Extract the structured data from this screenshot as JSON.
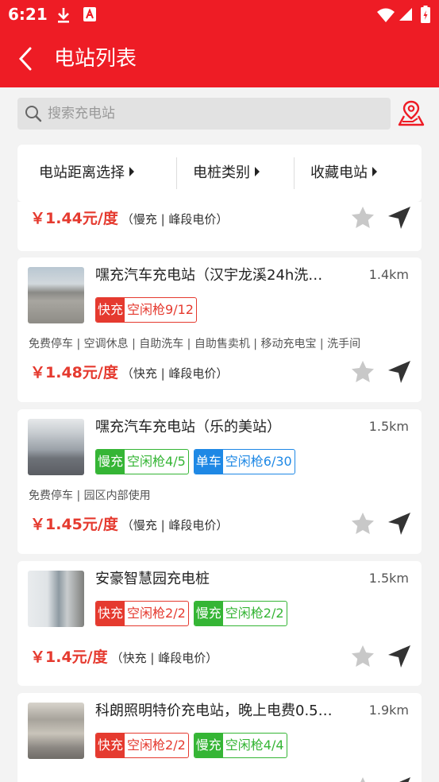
{
  "status_bar": {
    "time": "6:21"
  },
  "header": {
    "title": "电站列表"
  },
  "search": {
    "placeholder": "搜索充电站"
  },
  "filters": [
    {
      "label": "电站距离选择"
    },
    {
      "label": "电桩类别"
    },
    {
      "label": "收藏电站"
    }
  ],
  "partial_card": {
    "price": "￥1.44元/度",
    "price_desc": "（慢充 | 峰段电价）"
  },
  "stations": [
    {
      "name": "嘿充汽车充电站（汉宇龙溪24h洗…",
      "distance": "1.4km",
      "tags": [
        {
          "type": "快充",
          "avail": "空闲枪9/12",
          "kind": "fast"
        }
      ],
      "facilities": "免费停车 | 空调休息 | 自助洗车 | 自助售卖机 | 移动充电宝 | 洗手间",
      "price": "￥1.48元/度",
      "price_desc": "（快充 | 峰段电价）",
      "photo": "img-road"
    },
    {
      "name": "嘿充汽车充电站（乐的美站）",
      "distance": "1.5km",
      "tags": [
        {
          "type": "慢充",
          "avail": "空闲枪4/5",
          "kind": "slow"
        },
        {
          "type": "单车",
          "avail": "空闲枪6/30",
          "kind": "bike"
        }
      ],
      "facilities": "免费停车 | 园区内部使用",
      "price": "￥1.45元/度",
      "price_desc": "（慢充 | 峰段电价）",
      "photo": "img-bldg"
    },
    {
      "name": "安豪智慧园充电桩",
      "distance": "1.5km",
      "tags": [
        {
          "type": "快充",
          "avail": "空闲枪2/2",
          "kind": "fast"
        },
        {
          "type": "慢充",
          "avail": "空闲枪2/2",
          "kind": "slow"
        }
      ],
      "facilities": "",
      "price": "￥1.4元/度",
      "price_desc": "（快充 | 峰段电价）",
      "photo": "img-wall"
    },
    {
      "name": "科朗照明特价充电站，晚上电费0.5…",
      "distance": "1.9km",
      "tags": [
        {
          "type": "快充",
          "avail": "空闲枪2/2",
          "kind": "fast"
        },
        {
          "type": "慢充",
          "avail": "空闲枪4/4",
          "kind": "slow"
        }
      ],
      "facilities": "",
      "price": "",
      "price_desc": "",
      "photo": "img-shed"
    }
  ],
  "colors": {
    "brand": "#ee1c25",
    "price": "#e53a2f",
    "fast": "#e53a2f",
    "slow": "#35b535",
    "bike": "#1e88e5"
  }
}
